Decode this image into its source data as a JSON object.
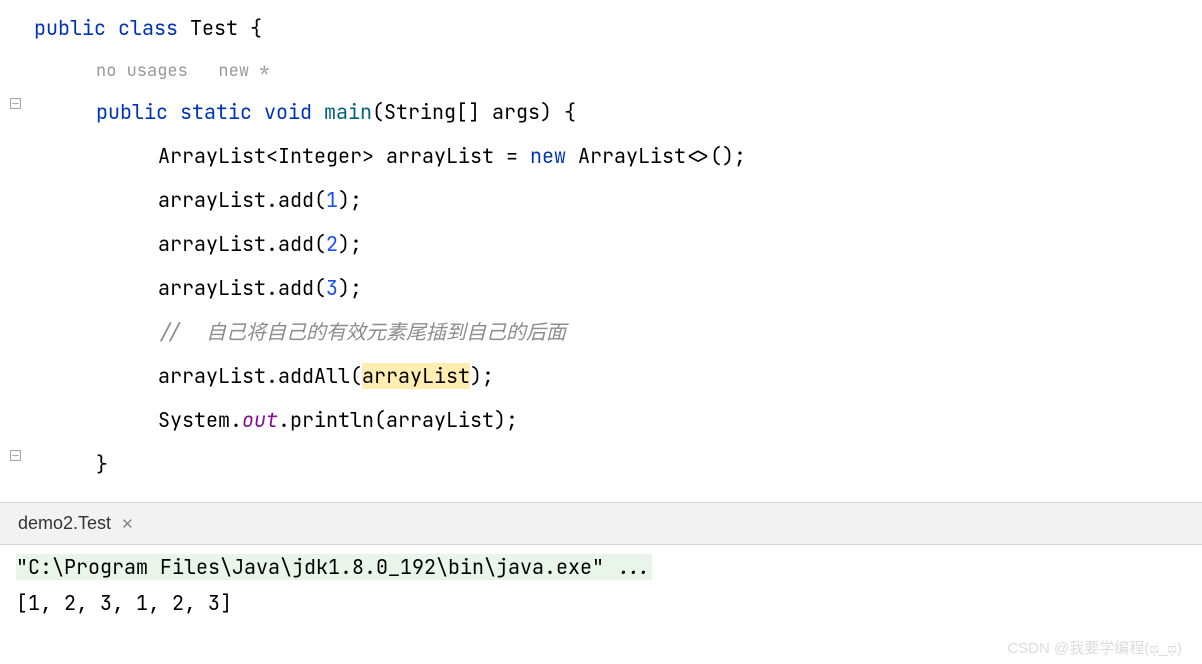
{
  "editor": {
    "class_line": {
      "kw_public": "public",
      "kw_class": "class",
      "class_name": "Test",
      "brace": "{"
    },
    "hints": {
      "usages": "no usages",
      "vcs": "new *"
    },
    "method_sig": {
      "kw_public": "public",
      "kw_static": "static",
      "kw_void": "void",
      "name": "main",
      "params": "(String[] args) {"
    },
    "lines": {
      "l1_a": "ArrayList<Integer> arrayList = ",
      "l1_new": "new",
      "l1_b": " ArrayList<>();",
      "l2": "arrayList.add(",
      "l2_n": "1",
      "l2_e": ");",
      "l3": "arrayList.add(",
      "l3_n": "2",
      "l3_e": ");",
      "l4": "arrayList.add(",
      "l4_n": "3",
      "l4_e": ");",
      "l5_prefix": "// ",
      "l5_comment": " 自己将自己的有效元素尾插到自己的后面",
      "l6_a": "arrayList.addAll(",
      "l6_hl": "arrayList",
      "l6_b": ");",
      "l7_a": "System.",
      "l7_out": "out",
      "l7_b": ".println(arrayList);",
      "close": "}"
    }
  },
  "tab": {
    "label": "demo2.Test"
  },
  "console": {
    "cmd_a": "\"C:\\Program Files\\Java\\jdk1.8.0_192\\bin\\java.exe\"",
    "cmd_b": " ...",
    "output": "[1, 2, 3, 1, 2, 3]"
  },
  "watermark": "CSDN @我要学编程(ಥ_ಥ)"
}
